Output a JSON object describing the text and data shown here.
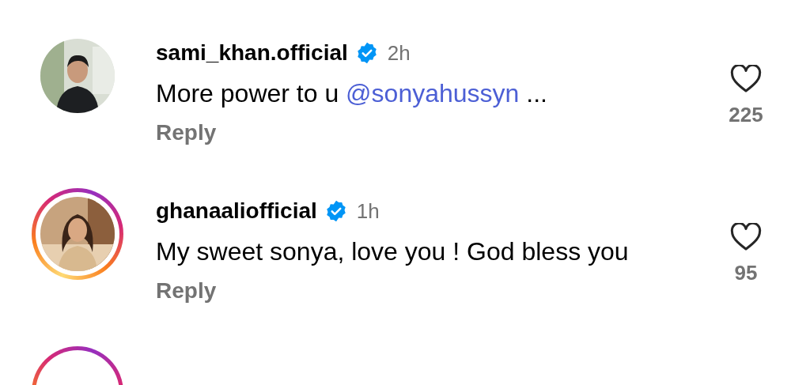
{
  "comments": [
    {
      "username": "sami_khan.official",
      "verified": true,
      "time": "2h",
      "text": "More power to u",
      "mention": "@sonyahussyn",
      "suffix": " ...",
      "reply": "Reply",
      "likes": "225",
      "has_story": false
    },
    {
      "username": "ghanaaliofficial",
      "verified": true,
      "time": "1h",
      "text": "My sweet sonya, love you ! God bless you",
      "reply": "Reply",
      "likes": "95",
      "has_story": true
    },
    {
      "has_story": true
    }
  ]
}
